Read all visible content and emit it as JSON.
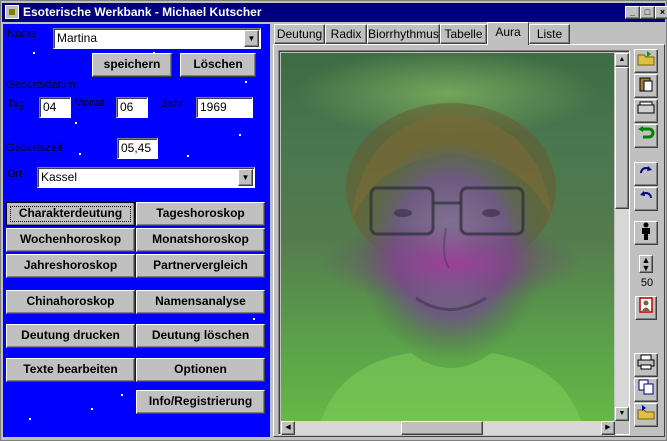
{
  "window": {
    "title": "Esoterische Werkbank - Michael Kutscher"
  },
  "titlebar_buttons": {
    "minimize": "_",
    "maximize": "□",
    "close": "×"
  },
  "form": {
    "name_label": "Name",
    "name_value": "Martina",
    "save_button": "speichern",
    "delete_button": "Löschen",
    "birthdate_label": "Geburtsdatum",
    "day_label": "Tag",
    "day_value": "04",
    "month_label": "Monat",
    "month_value": "06",
    "year_label": "Jahr",
    "year_value": "1969",
    "birthtime_label": "Geburtszeit",
    "birthtime_value": "05,45",
    "place_label": "Ort",
    "place_value": "Kassel"
  },
  "actions": [
    "Charakterdeutung",
    "Tageshoroskop",
    "Wochenhoroskop",
    "Monatshoroskop",
    "Jahreshoroskop",
    "Partnervergleich",
    "Chinahoroskop",
    "Namensanalyse",
    "Deutung drucken",
    "Deutung löschen",
    "Texte bearbeiten",
    "Optionen",
    "Info/Registrierung"
  ],
  "tabs": [
    "Deutung",
    "Radix",
    "Biorrhythmus",
    "Tabelle",
    "Aura",
    "Liste"
  ],
  "selected_tab": "Aura",
  "toolbar": {
    "zoom_value": "50",
    "icons": [
      "open-folder-icon",
      "paste-icon",
      "scanner-icon",
      "undo-icon",
      "rotate-right-icon",
      "rotate-left-icon",
      "person-icon",
      "spin-icon",
      "portrait-icon",
      "print-icon",
      "copy-icon",
      "export-folder-icon"
    ]
  },
  "colors": {
    "title_bar": "#000080",
    "left_panel": "#0000ff",
    "face_area": "#c0c0c0",
    "aura_top": "#3c7a3c",
    "aura_bottom": "#5fb84f"
  }
}
